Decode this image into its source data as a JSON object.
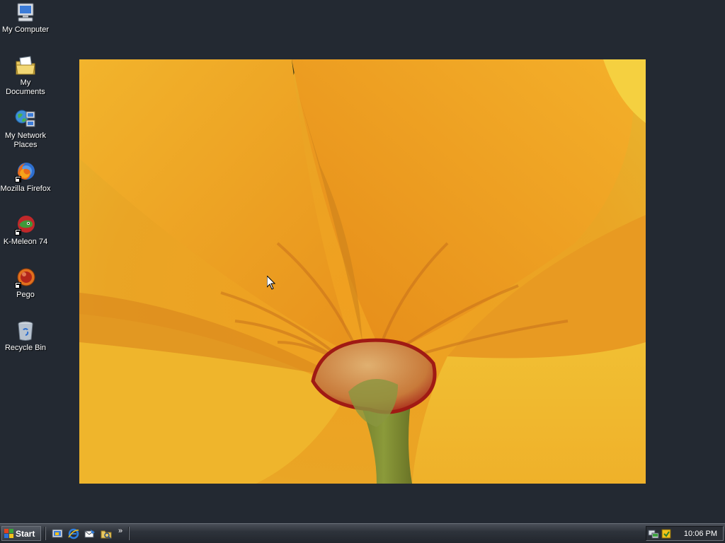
{
  "desktop": {
    "background_color": "#232932",
    "icons": [
      {
        "label": "My Computer",
        "icon": "my-computer-icon"
      },
      {
        "label": "My Documents",
        "icon": "my-documents-icon"
      },
      {
        "label": "My Network Places",
        "icon": "network-places-icon"
      },
      {
        "label": "Mozilla Firefox",
        "icon": "firefox-icon"
      },
      {
        "label": "K-Meleon 74",
        "icon": "k-meleon-icon"
      },
      {
        "label": "Pego",
        "icon": "pego-icon"
      },
      {
        "label": "Recycle Bin",
        "icon": "recycle-bin-icon"
      }
    ],
    "wallpaper": {
      "subject": "yellow-orange flower petals close-up",
      "icon": "wallpaper-image"
    }
  },
  "taskbar": {
    "start_label": "Start",
    "quick_launch": [
      {
        "icon": "show-desktop-icon"
      },
      {
        "icon": "internet-explorer-icon"
      },
      {
        "icon": "outlook-express-icon"
      },
      {
        "icon": "windows-explorer-icon"
      }
    ],
    "quick_launch_more": "»",
    "tray": {
      "icons": [
        {
          "icon": "network-tray-icon"
        },
        {
          "icon": "update-tray-icon"
        }
      ],
      "clock": "10:06 PM"
    }
  }
}
